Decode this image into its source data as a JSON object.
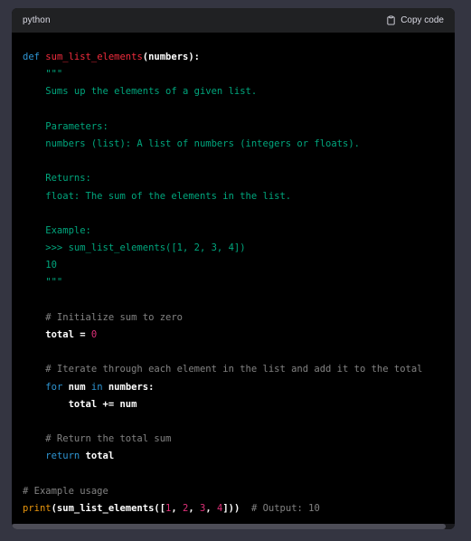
{
  "header": {
    "language": "python",
    "copy_label": "Copy code"
  },
  "colors": {
    "page_background": "#343541",
    "header_background": "#202123",
    "code_background": "#000000",
    "keyword": "#2e95d3",
    "function": "#f22c3d",
    "builtin": "#e9950c",
    "string": "#00a67d",
    "number": "#df3079",
    "comment": "rgba(255,255,255,0.5)"
  },
  "icons": {
    "copy": "clipboard-icon"
  },
  "code": {
    "lines": [
      [
        {
          "t": "def",
          "c": "keyword"
        },
        {
          "t": " ",
          "c": "plain"
        },
        {
          "t": "sum_list_elements",
          "c": "function"
        },
        {
          "t": "(numbers):",
          "c": "bold"
        }
      ],
      [
        {
          "t": "    \"\"\"",
          "c": "string"
        }
      ],
      [
        {
          "t": "    Sums up the elements of a given list.",
          "c": "string"
        }
      ],
      [],
      [
        {
          "t": "    Parameters:",
          "c": "string"
        }
      ],
      [
        {
          "t": "    numbers (list): A list of numbers (integers or floats).",
          "c": "string"
        }
      ],
      [],
      [
        {
          "t": "    Returns:",
          "c": "string"
        }
      ],
      [
        {
          "t": "    float: The sum of the elements in the list.",
          "c": "string"
        }
      ],
      [],
      [
        {
          "t": "    Example:",
          "c": "string"
        }
      ],
      [
        {
          "t": "    >>> sum_list_elements([1, 2, 3, 4])",
          "c": "string"
        }
      ],
      [
        {
          "t": "    10",
          "c": "string"
        }
      ],
      [
        {
          "t": "    \"\"\"",
          "c": "string"
        }
      ],
      [],
      [
        {
          "t": "    # Initialize sum to zero",
          "c": "comment"
        }
      ],
      [
        {
          "t": "    total = ",
          "c": "bold"
        },
        {
          "t": "0",
          "c": "number"
        }
      ],
      [],
      [
        {
          "t": "    # Iterate through each element in the list and add it to the total",
          "c": "comment"
        }
      ],
      [
        {
          "t": "    ",
          "c": "plain"
        },
        {
          "t": "for",
          "c": "keyword"
        },
        {
          "t": " num ",
          "c": "bold"
        },
        {
          "t": "in",
          "c": "keyword"
        },
        {
          "t": " numbers:",
          "c": "bold"
        }
      ],
      [
        {
          "t": "        total += num",
          "c": "bold"
        }
      ],
      [],
      [
        {
          "t": "    # Return the total sum",
          "c": "comment"
        }
      ],
      [
        {
          "t": "    ",
          "c": "plain"
        },
        {
          "t": "return",
          "c": "keyword"
        },
        {
          "t": " total",
          "c": "bold"
        }
      ],
      [],
      [
        {
          "t": "# Example usage",
          "c": "comment"
        }
      ],
      [
        {
          "t": "print",
          "c": "builtin"
        },
        {
          "t": "(sum_list_elements([",
          "c": "bold"
        },
        {
          "t": "1",
          "c": "number"
        },
        {
          "t": ", ",
          "c": "bold"
        },
        {
          "t": "2",
          "c": "number"
        },
        {
          "t": ", ",
          "c": "bold"
        },
        {
          "t": "3",
          "c": "number"
        },
        {
          "t": ", ",
          "c": "bold"
        },
        {
          "t": "4",
          "c": "number"
        },
        {
          "t": "]))  ",
          "c": "bold"
        },
        {
          "t": "# Output: 10",
          "c": "comment"
        }
      ]
    ]
  }
}
